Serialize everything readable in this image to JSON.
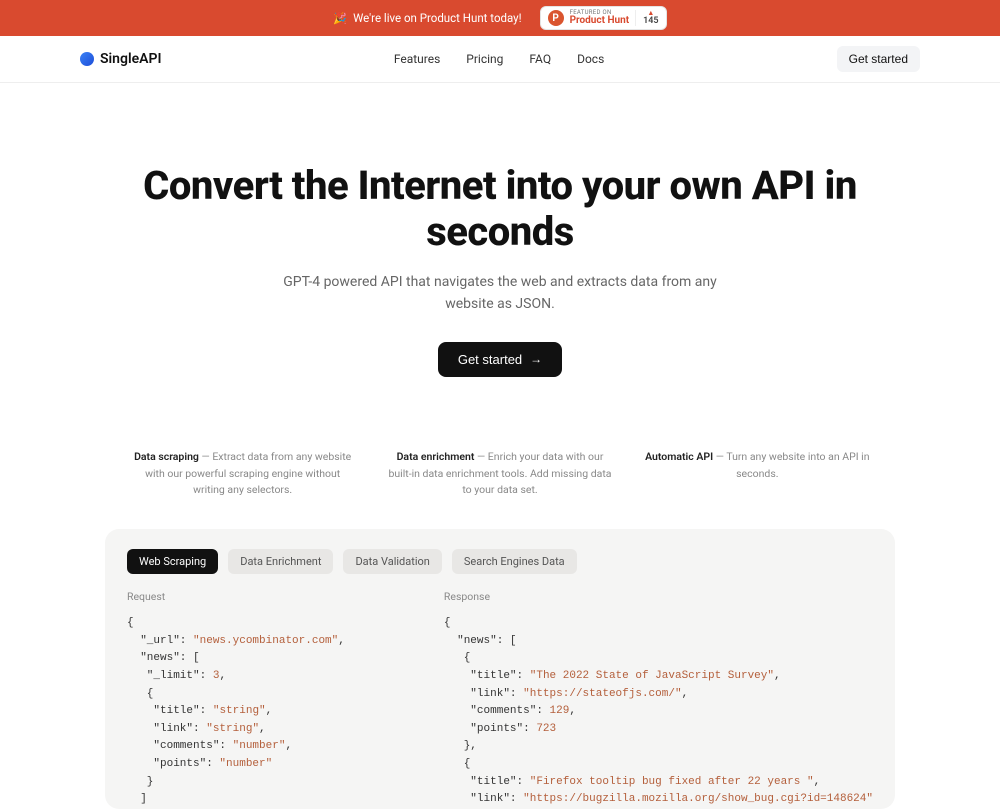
{
  "announcement": {
    "text": "We're live on Product Hunt today!",
    "emoji": "🎉",
    "ph": {
      "featured_on": "FEATURED ON",
      "name": "Product Hunt",
      "votes": "145"
    }
  },
  "brand": "SingleAPI",
  "nav": {
    "features": "Features",
    "pricing": "Pricing",
    "faq": "FAQ",
    "docs": "Docs",
    "cta": "Get started"
  },
  "hero": {
    "title": "Convert the Internet into your own API in seconds",
    "subtitle": "GPT-4 powered API that navigates the web and extracts data from any website as JSON.",
    "cta": "Get started"
  },
  "features": [
    {
      "title": "Data scraping",
      "body": "Extract data from any website with our powerful scraping engine without writing any selectors."
    },
    {
      "title": "Data enrichment",
      "body": "Enrich your data with our built-in data enrichment tools. Add missing data to your data set."
    },
    {
      "title": "Automatic API",
      "body": "Turn any website into an API in seconds."
    }
  ],
  "tabs": {
    "web_scraping": "Web Scraping",
    "data_enrichment": "Data Enrichment",
    "data_validation": "Data Validation",
    "search_engines": "Search Engines Data"
  },
  "code": {
    "request_label": "Request",
    "response_label": "Response",
    "request": {
      "url": "news.ycombinator.com",
      "limit": "3",
      "title_type": "string",
      "link_type": "string",
      "comments_type": "number",
      "points_type": "number"
    },
    "response": {
      "item1_title": "The 2022 State of JavaScript Survey",
      "item1_link": "https://stateofjs.com/",
      "item1_comments": "129",
      "item1_points": "723",
      "item2_title": "Firefox tooltip bug fixed after 22 years ",
      "item2_link": "https://bugzilla.mozilla.org/show_bug.cgi?id=148624"
    }
  }
}
